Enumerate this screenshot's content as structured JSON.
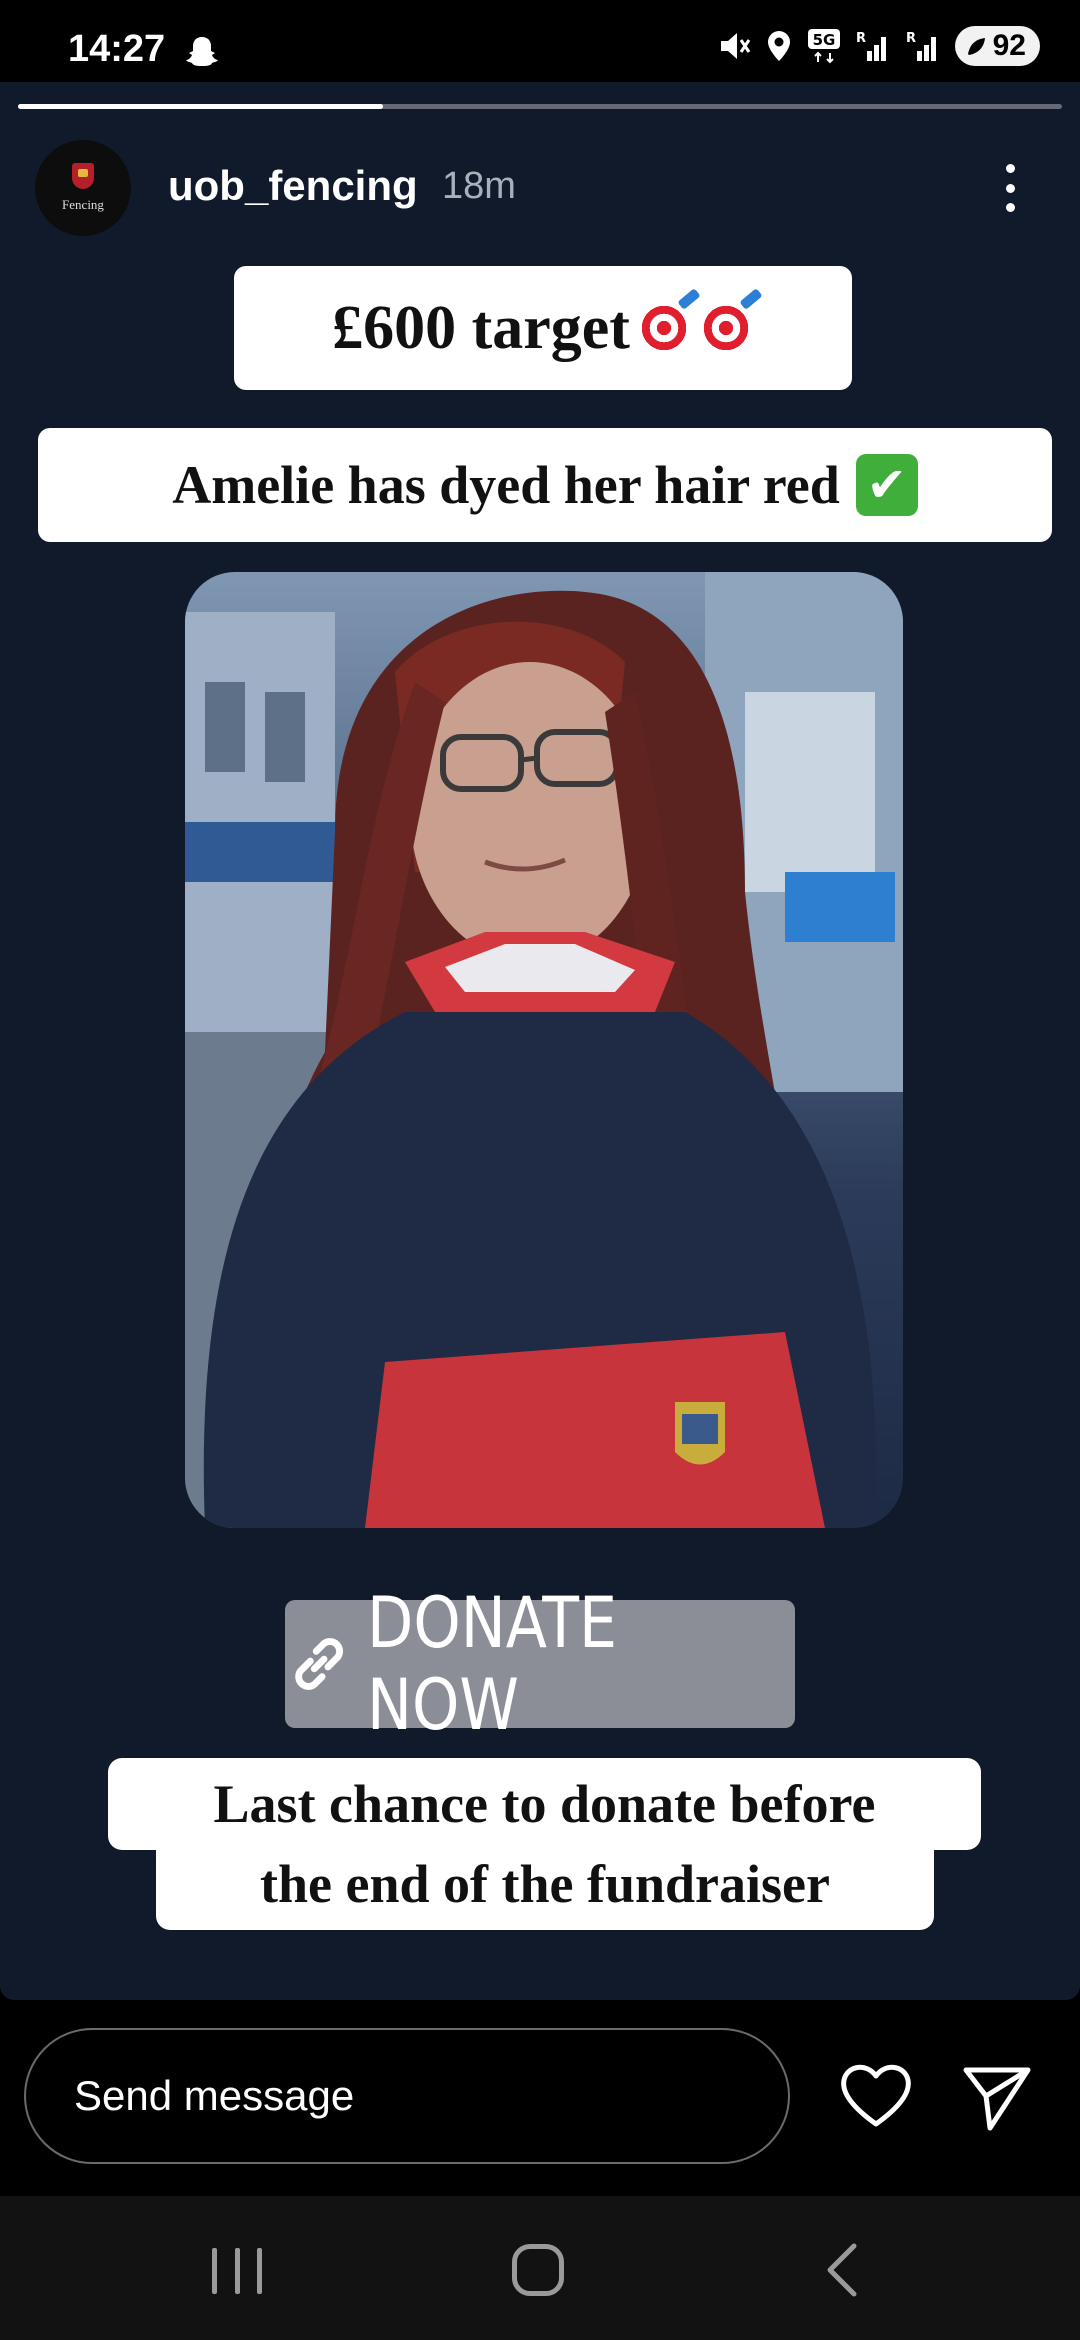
{
  "status_bar": {
    "time": "14:27",
    "battery": "92",
    "icons": [
      "snapchat-ghost-icon",
      "mute-icon",
      "location-icon",
      "5g-icon",
      "signal-icon",
      "signal-icon",
      "battery-icon"
    ]
  },
  "story": {
    "progress": 0.35,
    "username": "uob_fencing",
    "time_ago": "18m",
    "avatar_text": "Fencing",
    "sticker_target": "£600 target",
    "sticker_status": "Amelie has dyed her hair red",
    "link_label": "DONATE NOW",
    "caption_line1": "Last chance to donate before",
    "caption_line2": "the end of the fundraiser"
  },
  "reply_bar": {
    "placeholder": "Send message"
  },
  "colors": {
    "story_background": "#111a2b",
    "link_button": "#8b8e96",
    "sticker": "#ffffff"
  }
}
